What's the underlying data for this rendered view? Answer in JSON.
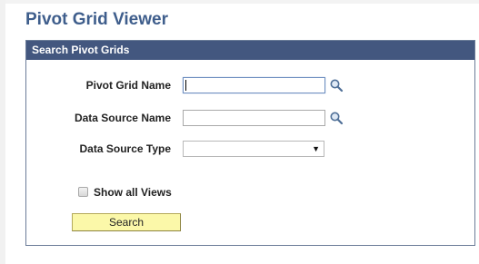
{
  "page": {
    "title": "Pivot Grid Viewer"
  },
  "panel": {
    "header": "Search Pivot Grids"
  },
  "fields": {
    "pivot_grid_name": {
      "label": "Pivot Grid Name",
      "value": ""
    },
    "data_source_name": {
      "label": "Data Source Name",
      "value": ""
    },
    "data_source_type": {
      "label": "Data Source Type",
      "selected": ""
    }
  },
  "options": {
    "show_all_views_label": "Show all Views",
    "show_all_views_checked": false
  },
  "actions": {
    "search_label": "Search"
  },
  "icons": {
    "lookup": "magnifying-glass-icon",
    "dropdown": "triangle-down-icon"
  },
  "colors": {
    "title": "#3f5e8c",
    "header_bg": "#43577f",
    "button_bg": "#fbf8a9"
  }
}
